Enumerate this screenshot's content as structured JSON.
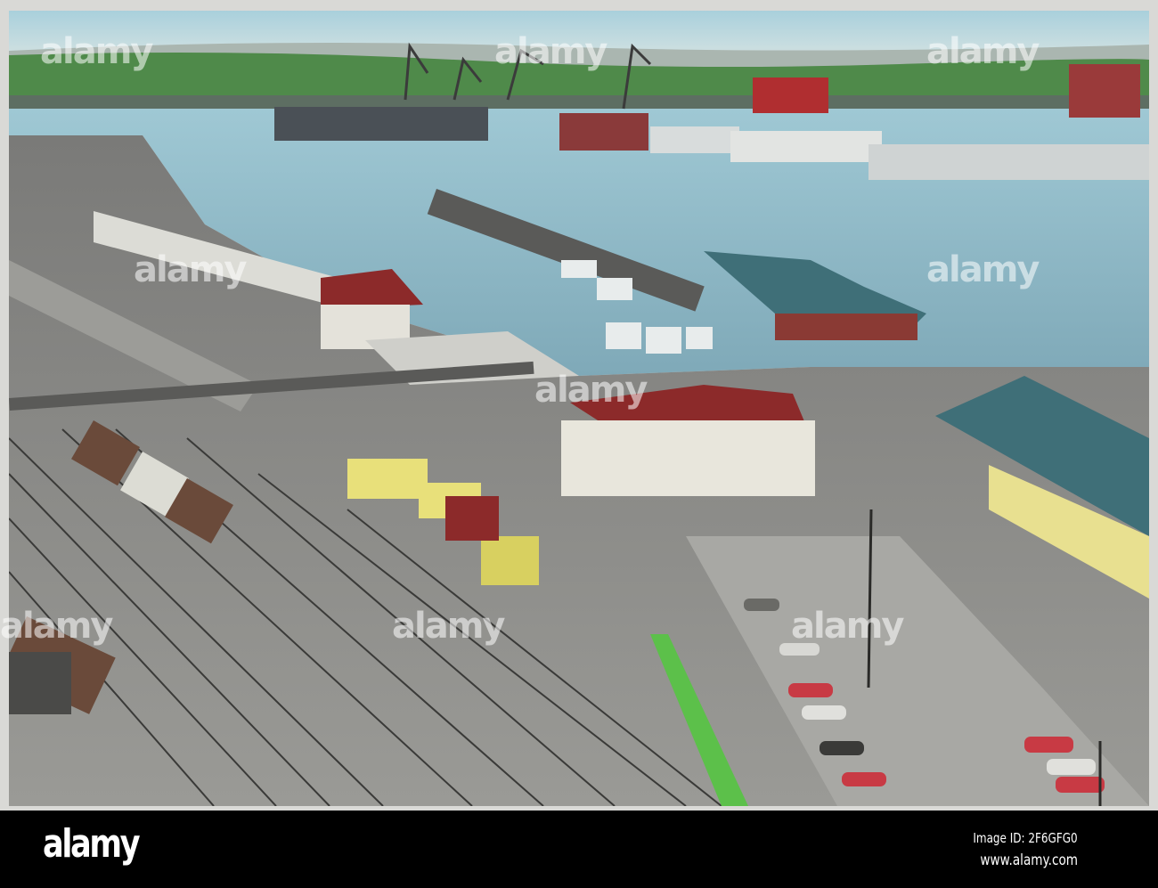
{
  "photo": {
    "subject": "hand-colored harbor and railway yard postcard",
    "colors": {
      "sky": "#9fc9d6",
      "hills": "#4f8a4a",
      "water": "#8fb9c6",
      "land": "#8d8d8a",
      "roof_red": "#8c2a2a",
      "roof_teal": "#3f6f78",
      "cargo_yellow": "#e8e07a",
      "grass": "#5cc04a"
    }
  },
  "watermark": {
    "text": "alamy"
  },
  "footer": {
    "logo": "alamy",
    "image_id": "Image ID: 2F6GFG0",
    "website": "www.alamy.com"
  }
}
